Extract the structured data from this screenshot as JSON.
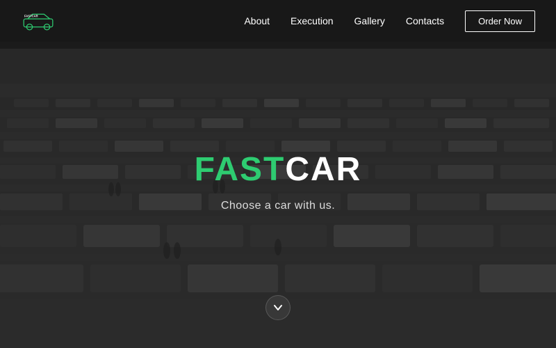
{
  "meta": {
    "site_title": "FastCar"
  },
  "nav": {
    "logo_text": "FASTCAR",
    "links": [
      {
        "label": "About",
        "id": "about"
      },
      {
        "label": "Execution",
        "id": "execution"
      },
      {
        "label": "Gallery",
        "id": "gallery"
      },
      {
        "label": "Contacts",
        "id": "contacts"
      }
    ],
    "cta_label": "Order Now"
  },
  "hero": {
    "title_fast": "FAST",
    "title_car": "CAR",
    "subtitle": "Choose a car with us."
  },
  "scroll": {
    "chevron": "❯"
  },
  "colors": {
    "accent_green": "#2ecc71",
    "text_white": "#ffffff",
    "bg_dark": "#2a2a2a"
  }
}
